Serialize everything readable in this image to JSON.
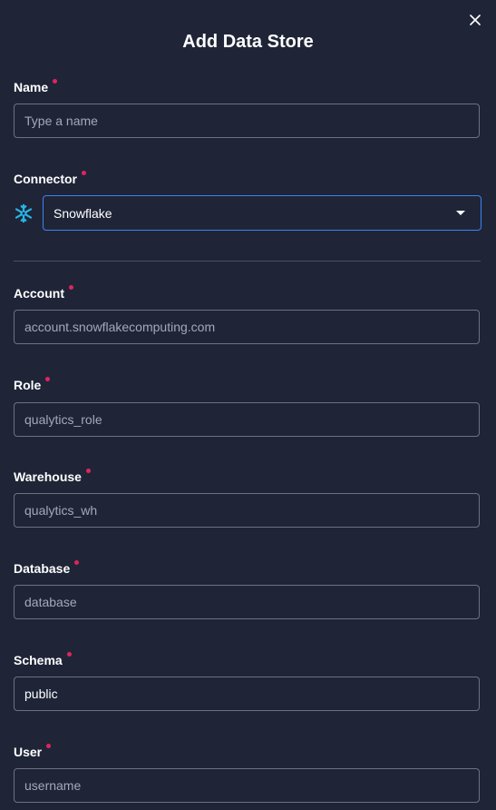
{
  "dialog": {
    "title": "Add Data Store",
    "close_icon": "close-icon"
  },
  "fields": {
    "name": {
      "label": "Name",
      "placeholder": "Type a name",
      "value": ""
    },
    "connector": {
      "label": "Connector",
      "value": "Snowflake",
      "icon": "snowflake-icon"
    },
    "account": {
      "label": "Account",
      "placeholder": "account.snowflakecomputing.com",
      "value": ""
    },
    "role": {
      "label": "Role",
      "placeholder": "qualytics_role",
      "value": ""
    },
    "warehouse": {
      "label": "Warehouse",
      "placeholder": "qualytics_wh",
      "value": ""
    },
    "database": {
      "label": "Database",
      "placeholder": "database",
      "value": ""
    },
    "schema": {
      "label": "Schema",
      "placeholder": "",
      "value": "public"
    },
    "user": {
      "label": "User",
      "placeholder": "username",
      "value": ""
    }
  },
  "colors": {
    "background": "#1f2537",
    "required": "#e0245e",
    "focus_border": "#3b82f6",
    "snowflake": "#29b5e8"
  }
}
